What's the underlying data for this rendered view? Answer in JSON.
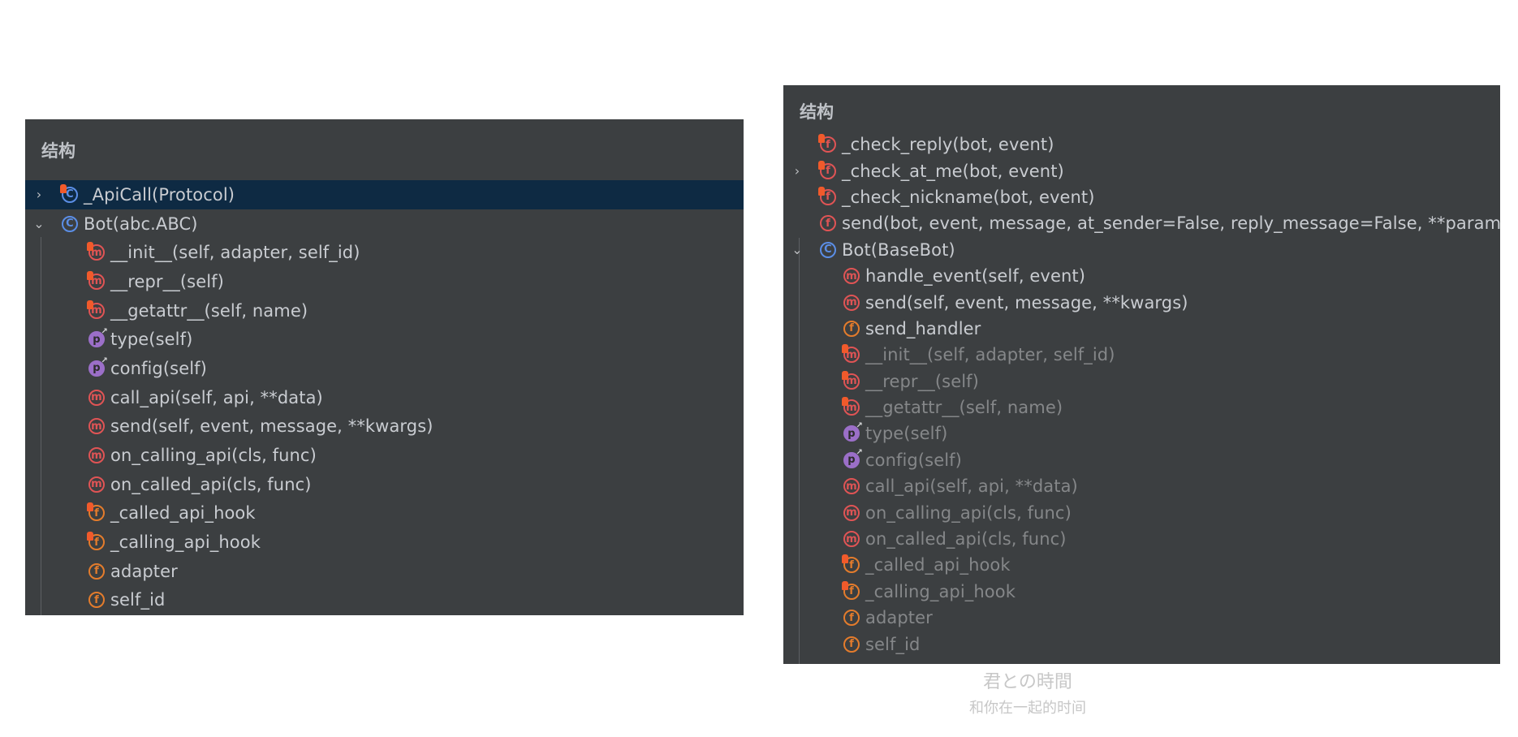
{
  "left_panel": {
    "title": "结构",
    "items": [
      {
        "label": "_ApiCall(Protocol)",
        "icon": "class-icon",
        "chevron": "›",
        "selected": true
      },
      {
        "label": "Bot(abc.ABC)",
        "icon": "class-icon",
        "chevron": "⌄"
      },
      {
        "label": "__init__(self, adapter, self_id)",
        "icon": "method-pinned-icon"
      },
      {
        "label": "__repr__(self)",
        "icon": "method-pinned-icon"
      },
      {
        "label": "__getattr__(self, name)",
        "icon": "method-pinned-icon"
      },
      {
        "label": "type(self)",
        "icon": "property-icon"
      },
      {
        "label": "config(self)",
        "icon": "property-icon"
      },
      {
        "label": "call_api(self, api, **data)",
        "icon": "method-icon"
      },
      {
        "label": "send(self, event, message, **kwargs)",
        "icon": "method-icon"
      },
      {
        "label": "on_calling_api(cls, func)",
        "icon": "method-icon"
      },
      {
        "label": "on_called_api(cls, func)",
        "icon": "method-icon"
      },
      {
        "label": "_called_api_hook",
        "icon": "field-pinned-icon"
      },
      {
        "label": "_calling_api_hook",
        "icon": "field-pinned-icon"
      },
      {
        "label": "adapter",
        "icon": "field-icon"
      },
      {
        "label": "self_id",
        "icon": "field-icon"
      }
    ]
  },
  "right_panel": {
    "title": "结构",
    "items": [
      {
        "label": "_check_reply(bot, event)",
        "icon": "function-pinned-icon"
      },
      {
        "label": "_check_at_me(bot, event)",
        "icon": "function-pinned-icon",
        "chevron": "›"
      },
      {
        "label": "_check_nickname(bot, event)",
        "icon": "function-pinned-icon"
      },
      {
        "label": "send(bot, event, message, at_sender=False, reply_message=False, **params)",
        "icon": "function-icon"
      },
      {
        "label": "Bot(BaseBot)",
        "icon": "class-icon",
        "chevron": "⌄"
      },
      {
        "label": "handle_event(self, event)",
        "icon": "method-icon"
      },
      {
        "label": "send(self, event, message, **kwargs)",
        "icon": "method-icon"
      },
      {
        "label": "send_handler",
        "icon": "field-icon"
      },
      {
        "label": "__init__(self, adapter, self_id)",
        "icon": "method-pinned-icon",
        "dim": true
      },
      {
        "label": "__repr__(self)",
        "icon": "method-pinned-icon",
        "dim": true
      },
      {
        "label": "__getattr__(self, name)",
        "icon": "method-pinned-icon",
        "dim": true
      },
      {
        "label": "type(self)",
        "icon": "property-icon",
        "dim": true
      },
      {
        "label": "config(self)",
        "icon": "property-icon",
        "dim": true
      },
      {
        "label": "call_api(self, api, **data)",
        "icon": "method-icon",
        "dim": true
      },
      {
        "label": "on_calling_api(cls, func)",
        "icon": "method-icon",
        "dim": true
      },
      {
        "label": "on_called_api(cls, func)",
        "icon": "method-icon",
        "dim": true
      },
      {
        "label": "_called_api_hook",
        "icon": "field-pinned-icon",
        "dim": true
      },
      {
        "label": "_calling_api_hook",
        "icon": "field-pinned-icon",
        "dim": true
      },
      {
        "label": "adapter",
        "icon": "field-icon",
        "dim": true
      },
      {
        "label": "self_id",
        "icon": "field-icon",
        "dim": true
      }
    ]
  },
  "caption": {
    "line1": "君との時間",
    "line2": "和你在一起的时间"
  }
}
